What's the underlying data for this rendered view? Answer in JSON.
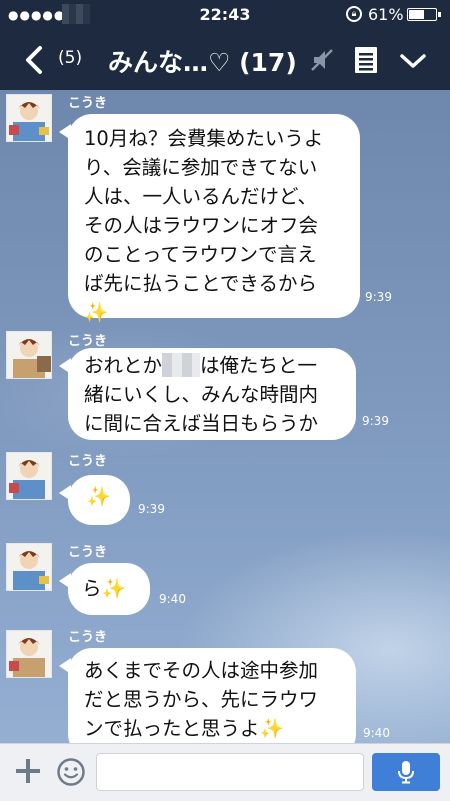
{
  "status_bar": {
    "signal_dots": "●●●●●",
    "time": "22:43",
    "battery_percent_label": "61%",
    "battery_level": 0.61
  },
  "header": {
    "back_count": "(5)",
    "title": "みんな…♡ (17)"
  },
  "messages": [
    {
      "sender": "こうき",
      "lines": [
        "10月ね？会費集めたいうよ",
        "り、会議に参加できてない",
        "人は、一人いるんだけど、",
        "その人はラウワンにオフ会",
        "のことってラウワンで言え",
        "ば先に払うことできるから",
        "✨"
      ],
      "time": "9:39"
    },
    {
      "sender": "こうき",
      "line1_before": "おれとか",
      "line1_after": "は俺たちと一",
      "lines": [
        "緒にいくし、みんな時間内",
        "に間に合えば当日もらうか"
      ],
      "time": "9:39"
    },
    {
      "sender": "こうき",
      "lines": [
        "✨"
      ],
      "time": "9:39"
    },
    {
      "sender": "こうき",
      "lines": [
        "ら✨"
      ],
      "time": "9:40"
    },
    {
      "sender": "こうき",
      "lines": [
        "あくまでその人は途中参加",
        "だと思うから、先にラウワ",
        "ンで払ったと思うよ✨"
      ],
      "time": "9:40"
    }
  ],
  "input_bar": {
    "placeholder": ""
  },
  "colors": {
    "header_bg": "#1d2a3f",
    "chat_bg": "#7d97bd",
    "bubble_bg": "#ffffff",
    "send_button": "#3f7fd8"
  },
  "icons": [
    "back-chevron-icon",
    "mute-icon",
    "notes-icon",
    "chevron-down-icon",
    "plus-icon",
    "emoji-icon",
    "microphone-icon"
  ]
}
